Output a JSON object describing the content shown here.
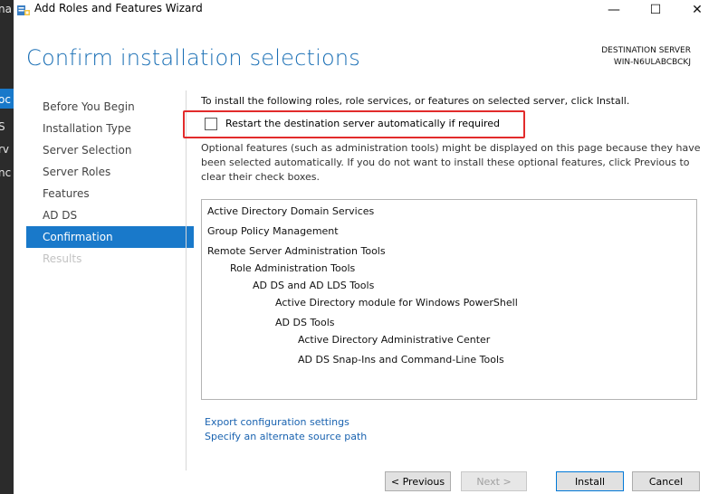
{
  "window": {
    "title": "Add Roles and Features Wizard",
    "minimize_glyph": "—",
    "maximize_glyph": "☐",
    "close_glyph": "✕"
  },
  "background_fragments": [
    "na",
    "oc",
    "S",
    "rv",
    "nc"
  ],
  "header": {
    "page_title": "Confirm installation selections",
    "destination_label": "DESTINATION SERVER",
    "destination_server": "WIN-N6ULABCBCKJ"
  },
  "nav": {
    "items": [
      {
        "label": "Before You Begin",
        "state": "normal"
      },
      {
        "label": "Installation Type",
        "state": "normal"
      },
      {
        "label": "Server Selection",
        "state": "normal"
      },
      {
        "label": "Server Roles",
        "state": "normal"
      },
      {
        "label": "Features",
        "state": "normal"
      },
      {
        "label": "AD DS",
        "state": "normal"
      },
      {
        "label": "Confirmation",
        "state": "active"
      },
      {
        "label": "Results",
        "state": "disabled"
      }
    ]
  },
  "content": {
    "intro": "To install the following roles, role services, or features on selected server, click Install.",
    "restart": {
      "label": "Restart the destination server automatically if required",
      "checked": false
    },
    "optional_note": "Optional features (such as administration tools) might be displayed on this page because they have been selected automatically. If you do not want to install these optional features, click Previous to clear their check boxes.",
    "features": [
      {
        "label": "Active Directory Domain Services",
        "level": 0
      },
      {
        "label": "Group Policy Management",
        "level": 0
      },
      {
        "label": "Remote Server Administration Tools",
        "level": 0
      },
      {
        "label": "Role Administration Tools",
        "level": 1
      },
      {
        "label": "AD DS and AD LDS Tools",
        "level": 2
      },
      {
        "label": "Active Directory module for Windows PowerShell",
        "level": 3
      },
      {
        "label": "AD DS Tools",
        "level": 3
      },
      {
        "label": "Active Directory Administrative Center",
        "level": 4
      },
      {
        "label": "AD DS Snap-Ins and Command-Line Tools",
        "level": 4
      }
    ],
    "links": {
      "export": "Export configuration settings",
      "alternate_source": "Specify an alternate source path"
    }
  },
  "buttons": {
    "previous": "< Previous",
    "next": "Next >",
    "install": "Install",
    "cancel": "Cancel"
  },
  "colors": {
    "accent": "#1979ca",
    "title_blue": "#1a6fb5",
    "highlight_red": "#e22b2b",
    "link_blue": "#1a63b0"
  }
}
